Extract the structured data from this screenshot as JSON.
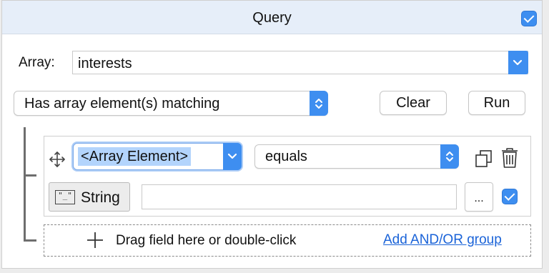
{
  "header": {
    "title": "Query",
    "enabled": true
  },
  "array_row": {
    "label": "Array:",
    "value": "interests"
  },
  "mode_select": {
    "value": "Has array element(s) matching"
  },
  "buttons": {
    "clear": "Clear",
    "run": "Run"
  },
  "rule": {
    "field": "<Array Element>",
    "operator": "equals",
    "value_type": "String",
    "value_type_icon": "\"_\"",
    "value": "",
    "more_label": "...",
    "enabled": true
  },
  "dropzone": {
    "hint": "Drag field here or double-click",
    "add_group": "Add AND/OR group"
  },
  "colors": {
    "accent": "#3e8ef0",
    "header_bg": "#e6eef9",
    "link": "#1a63d8",
    "selection": "#b3d4fc"
  },
  "icons": [
    "checkbox-icon",
    "chevron-down-icon",
    "updown-arrows-icon",
    "move-icon",
    "duplicate-icon",
    "trash-icon",
    "string-type-icon",
    "plus-icon"
  ]
}
